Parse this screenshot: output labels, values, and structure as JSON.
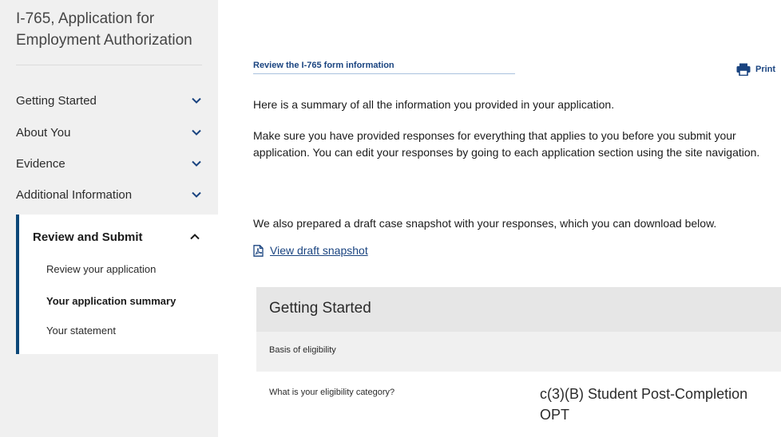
{
  "sidebar": {
    "form_title": "I-765, Application for Employment Authorization",
    "items": [
      {
        "label": "Getting Started"
      },
      {
        "label": "About You"
      },
      {
        "label": "Evidence"
      },
      {
        "label": "Additional Information"
      }
    ],
    "active_section": {
      "label": "Review and Submit",
      "sub_items": [
        {
          "label": "Review your application"
        },
        {
          "label": "Your application summary"
        },
        {
          "label": "Your statement"
        }
      ]
    }
  },
  "main": {
    "review_heading": "Review the I-765 form information",
    "print_label": "Print",
    "summary_text": "Here is a summary of all the information you provided in your application.",
    "instruction_text": "Make sure you have provided responses for everything that applies to you before you submit your application. You can edit your responses by going to each application section using the site navigation.",
    "snapshot_text": "We also prepared a draft case snapshot with your responses, which you can download below.",
    "snapshot_link": "View draft snapshot",
    "section": {
      "title": "Getting Started",
      "subsection": "Basis of eligibility",
      "question": "What is your eligibility category?",
      "answer": "c(3)(B) Student Post-Completion OPT"
    }
  },
  "colors": {
    "accent": "#1a4480",
    "active_border": "#0b4778",
    "sidebar_bg": "#f0f0f0"
  },
  "icons": {
    "chevron_down": "chevron-down-icon",
    "chevron_up": "chevron-up-icon",
    "print": "printer-icon",
    "pdf": "pdf-file-icon"
  }
}
